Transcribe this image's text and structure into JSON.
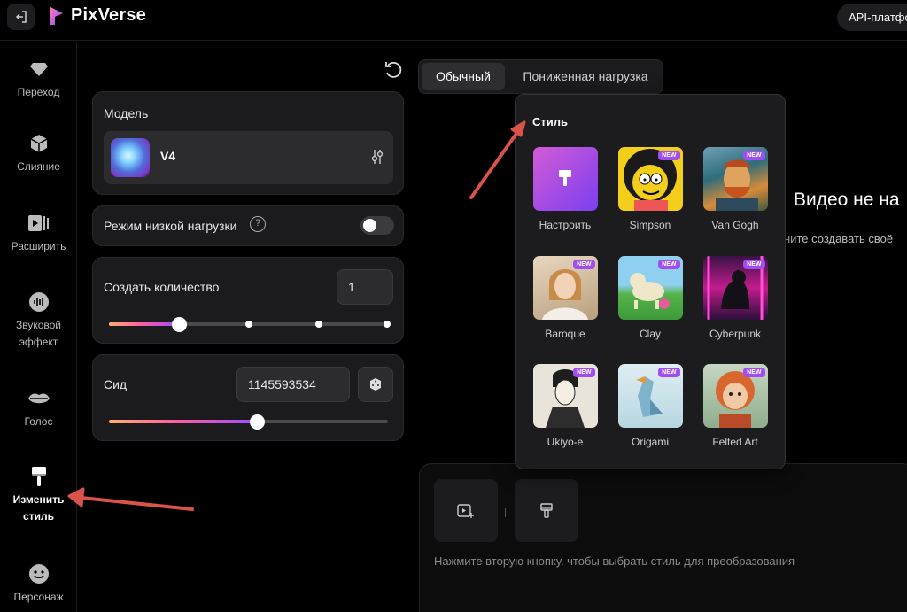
{
  "app": {
    "name": "PixVerse",
    "api_button": "API-платформа"
  },
  "sidebar": {
    "items": [
      {
        "label": "Переход",
        "icon": "diamond-icon"
      },
      {
        "label": "Слияние",
        "icon": "cube-icon"
      },
      {
        "label": "Расширить",
        "icon": "video-extend-icon"
      },
      {
        "label1": "Звуковой",
        "label2": "эффект",
        "icon": "sound-wave-icon"
      },
      {
        "label": "Голос",
        "icon": "lips-icon"
      },
      {
        "label1": "Изменить",
        "label2": "стиль",
        "icon": "paint-brush-icon",
        "active": true
      },
      {
        "label": "Персонаж",
        "icon": "smile-icon"
      }
    ]
  },
  "panel": {
    "model_label": "Модель",
    "model_name": "V4",
    "low_load_label": "Режим низкой нагрузки",
    "low_load_enabled": false,
    "quantity_label": "Создать количество",
    "quantity_value": "1",
    "quantity_slider_level": 0.25,
    "seed_label": "Сид",
    "seed_value": "1145593534",
    "seed_slider_level": 0.53
  },
  "tabs": [
    {
      "label": "Обычный",
      "active": true
    },
    {
      "label": "Пониженная нагрузка",
      "active": false
    }
  ],
  "empty_state": {
    "title": "Видео не на",
    "subtitle": "ните создавать своё"
  },
  "style_popup": {
    "title": "Стиль",
    "badge": "NEW",
    "styles": [
      {
        "name": "Настроить",
        "new": false
      },
      {
        "name": "Simpson",
        "new": true
      },
      {
        "name": "Van Gogh",
        "new": true
      },
      {
        "name": "Baroque",
        "new": true
      },
      {
        "name": "Clay",
        "new": true
      },
      {
        "name": "Cyberpunk",
        "new": true
      },
      {
        "name": "Ukiyo-e",
        "new": true
      },
      {
        "name": "Origami",
        "new": true
      },
      {
        "name": "Felted Art",
        "new": true
      }
    ]
  },
  "bottom": {
    "hint": "Нажмите вторую кнопку, чтобы выбрать стиль для преобразования"
  },
  "colors": {
    "accent_purple": "#a14ef0",
    "annotation_arrow": "#d9534a",
    "background": "#000000"
  }
}
